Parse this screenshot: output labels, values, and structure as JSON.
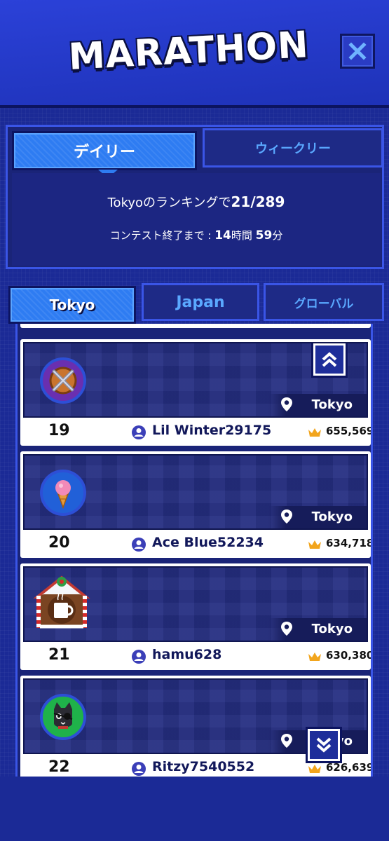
{
  "header": {
    "title": "MARATHON",
    "close_icon": "close-icon"
  },
  "contest": {
    "tabs": {
      "daily": "デイリー",
      "weekly": "ウィークリー"
    },
    "ranking_prefix": "Tokyoのランキングで",
    "ranking_value": "21/289",
    "time_prefix": "コンテスト終了まで : ",
    "time_hours": "14",
    "time_hours_unit": "時間 ",
    "time_minutes": "59",
    "time_minutes_unit": "分"
  },
  "region_tabs": {
    "tokyo": "Tokyo",
    "japan": "Japan",
    "global": "グローバル"
  },
  "leaderboard": [
    {
      "rank": "19",
      "name": "Lil Winter29175",
      "score": "655,569",
      "location": "Tokyo",
      "avatar": "crossed-swords-icon"
    },
    {
      "rank": "20",
      "name": "Ace Blue52234",
      "score": "634,718",
      "location": "Tokyo",
      "avatar": "ice-cream-icon"
    },
    {
      "rank": "21",
      "name": "hamu628",
      "score": "630,380",
      "location": "Tokyo",
      "avatar": "gingerbread-mug-icon"
    },
    {
      "rank": "22",
      "name": "Ritzy7540552",
      "score": "626,639",
      "location": "Tokyo",
      "avatar": "pirate-cat-icon"
    }
  ],
  "colors": {
    "accent": "#2e7cf2",
    "background": "#1b2a96",
    "tab_inactive_text": "#5aa8ff"
  }
}
